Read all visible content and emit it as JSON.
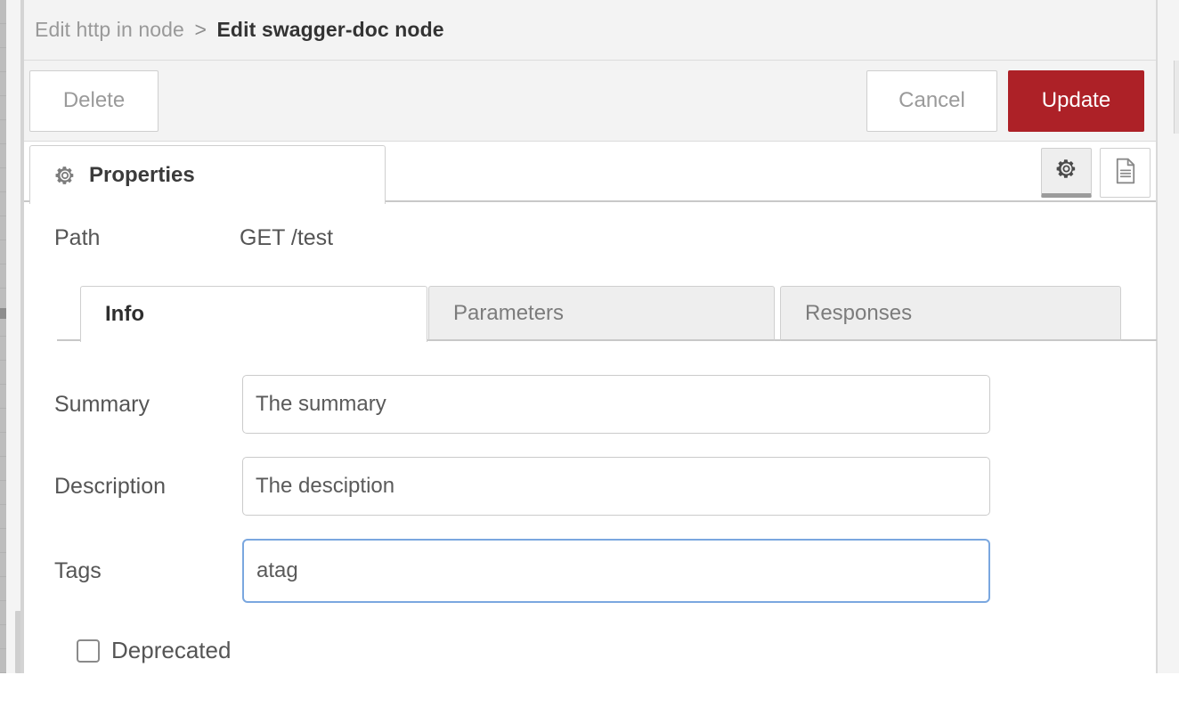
{
  "breadcrumb": {
    "parent": "Edit http in node",
    "separator": ">",
    "current": "Edit swagger-doc node"
  },
  "toolbar": {
    "delete_label": "Delete",
    "cancel_label": "Cancel",
    "update_label": "Update",
    "update_color": "#ad2127"
  },
  "tabstrip": {
    "properties_label": "Properties",
    "properties_icon": "gear-icon",
    "icon_buttons": [
      {
        "name": "gear-icon",
        "active": true
      },
      {
        "name": "description-document-icon",
        "active": false
      }
    ]
  },
  "body": {
    "path": {
      "label": "Path",
      "value": "GET /test"
    },
    "inner_tabs": [
      {
        "label": "Info",
        "active": true
      },
      {
        "label": "Parameters",
        "active": false
      },
      {
        "label": "Responses",
        "active": false
      }
    ],
    "fields": {
      "summary": {
        "label": "Summary",
        "value": "The summary",
        "placeholder": ""
      },
      "description": {
        "label": "Description",
        "value": "The desciption",
        "placeholder": ""
      },
      "tags": {
        "label": "Tags",
        "value": "atag",
        "placeholder": "",
        "focused": true,
        "focus_color": "#7aa7df"
      }
    },
    "deprecated": {
      "label": "Deprecated",
      "checked": false
    }
  }
}
